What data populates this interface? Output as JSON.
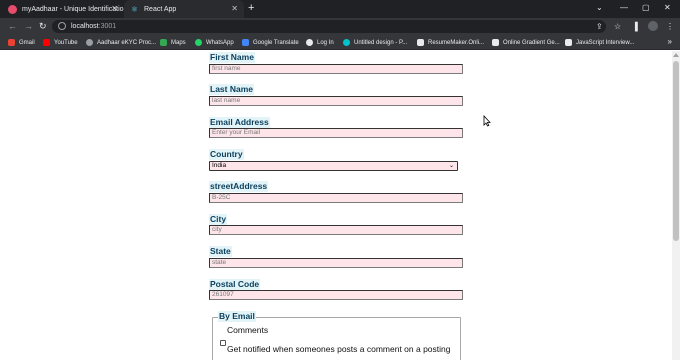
{
  "browser": {
    "tabs": [
      {
        "title": "myAadhaar - Unique Identificatio",
        "active": false
      },
      {
        "title": "React App",
        "active": true
      }
    ],
    "address": {
      "host": "localhost",
      "port": ":3001"
    },
    "bookmarks": [
      {
        "label": "Gmail",
        "color": "#ea4335"
      },
      {
        "label": "YouTube",
        "color": "#ff0000"
      },
      {
        "label": "Aadhaar eKYC Proc...",
        "color": "#9aa0a6"
      },
      {
        "label": "Maps",
        "color": "#34a853"
      },
      {
        "label": "WhatsApp",
        "color": "#25d366"
      },
      {
        "label": "Google Translate",
        "color": "#4285f4"
      },
      {
        "label": "Log In",
        "color": "#e8eaed"
      },
      {
        "label": "Untitled design - P...",
        "color": "#00c4cc"
      },
      {
        "label": "ResumeMaker.Onli...",
        "color": "#e8eaed"
      },
      {
        "label": "Online Gradient Ge...",
        "color": "#e8eaed"
      },
      {
        "label": "JavaScript Interview...",
        "color": "#e8eaed"
      }
    ]
  },
  "form": {
    "first_name": {
      "label": "First Name",
      "placeholder": "first name",
      "value": ""
    },
    "last_name": {
      "label": "Last Name",
      "placeholder": "last name",
      "value": ""
    },
    "email": {
      "label": "Email Address",
      "placeholder": "Enter your Email",
      "value": ""
    },
    "country": {
      "label": "Country",
      "selected": "India"
    },
    "street": {
      "label": "streetAddress",
      "placeholder": "B-25C",
      "value": ""
    },
    "city": {
      "label": "City",
      "placeholder": "city",
      "value": ""
    },
    "state": {
      "label": "State",
      "placeholder": "state",
      "value": ""
    },
    "postal": {
      "label": "Postal Code",
      "placeholder": "261097",
      "value": ""
    },
    "by_email": {
      "legend": "By Email",
      "comments_label": "Comments",
      "comments_desc": "Get notified when someones posts a comment on a posting"
    }
  }
}
